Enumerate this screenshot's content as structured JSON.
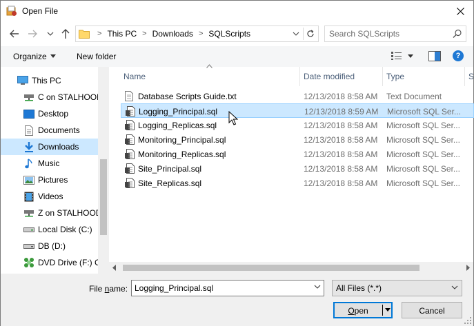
{
  "window": {
    "title": "Open File"
  },
  "address": {
    "crumbs": [
      "This PC",
      "Downloads",
      "SQLScripts"
    ],
    "search_placeholder": "Search SQLScripts"
  },
  "toolbar": {
    "organize_label": "Organize",
    "new_folder_label": "New folder",
    "help_label": "?"
  },
  "nav": {
    "items": [
      {
        "label": "This PC",
        "icon": "computer-icon"
      },
      {
        "label": "C on STALHOOD",
        "icon": "network-drive-icon"
      },
      {
        "label": "Desktop",
        "icon": "desktop-icon"
      },
      {
        "label": "Documents",
        "icon": "documents-icon"
      },
      {
        "label": "Downloads",
        "icon": "downloads-icon",
        "selected": true
      },
      {
        "label": "Music",
        "icon": "music-icon"
      },
      {
        "label": "Pictures",
        "icon": "pictures-icon"
      },
      {
        "label": "Videos",
        "icon": "videos-icon"
      },
      {
        "label": "Z on STALHOOD",
        "icon": "network-drive-icon"
      },
      {
        "label": "Local Disk (C:)",
        "icon": "disk-icon"
      },
      {
        "label": "DB (D:)",
        "icon": "disk-icon"
      },
      {
        "label": "DVD Drive (F:) CV",
        "icon": "dvd-icon"
      }
    ]
  },
  "columns": {
    "name": "Name",
    "date": "Date modified",
    "type": "Type",
    "size": "S"
  },
  "files": [
    {
      "name": "Database Scripts Guide.txt",
      "date": "12/13/2018 8:58 AM",
      "type": "Text Document",
      "icon": "text-file-icon"
    },
    {
      "name": "Logging_Principal.sql",
      "date": "12/13/2018 8:59 AM",
      "type": "Microsoft SQL Ser...",
      "icon": "sql-file-icon",
      "selected": true
    },
    {
      "name": "Logging_Replicas.sql",
      "date": "12/13/2018 8:58 AM",
      "type": "Microsoft SQL Ser...",
      "icon": "sql-file-icon"
    },
    {
      "name": "Monitoring_Principal.sql",
      "date": "12/13/2018 8:58 AM",
      "type": "Microsoft SQL Ser...",
      "icon": "sql-file-icon"
    },
    {
      "name": "Monitoring_Replicas.sql",
      "date": "12/13/2018 8:58 AM",
      "type": "Microsoft SQL Ser...",
      "icon": "sql-file-icon"
    },
    {
      "name": "Site_Principal.sql",
      "date": "12/13/2018 8:58 AM",
      "type": "Microsoft SQL Ser...",
      "icon": "sql-file-icon"
    },
    {
      "name": "Site_Replicas.sql",
      "date": "12/13/2018 8:58 AM",
      "type": "Microsoft SQL Ser...",
      "icon": "sql-file-icon"
    }
  ],
  "bottom": {
    "file_name_label_pre": "File ",
    "file_name_label_accel": "n",
    "file_name_label_post": "ame:",
    "file_name_value": "Logging_Principal.sql",
    "file_type_value": "All Files (*.*)",
    "open_accel": "O",
    "open_rest": "pen",
    "cancel_label": "Cancel"
  },
  "colors": {
    "selection_bg": "#cce8ff",
    "selection_border": "#99d1ff",
    "accent": "#0078d7"
  }
}
